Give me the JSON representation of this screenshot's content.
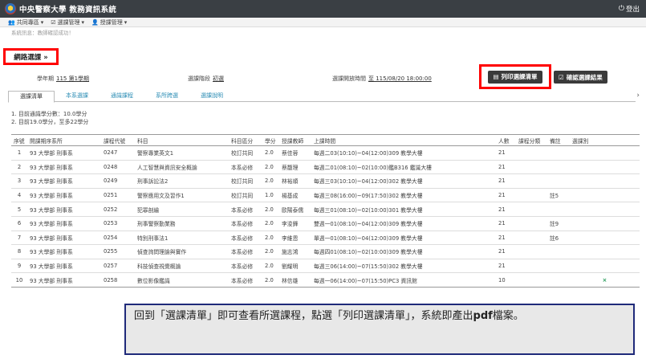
{
  "header": {
    "title": "中央警察大學 教務資訊系統",
    "logout": "登出"
  },
  "menu": [
    {
      "icon": "users-icon",
      "label": "共同專區"
    },
    {
      "icon": "checkbox-icon",
      "label": "選課管理"
    },
    {
      "icon": "user-icon",
      "label": "授課管理"
    }
  ],
  "notice": "系統訊息：教師確認成功！",
  "breadcrumb": "網路選課 »",
  "info": {
    "semester_label": "學年期",
    "semester_value": "115 第1學期",
    "stage_label": "選課階段",
    "stage_value": "初選",
    "open_label": "選課開放時間",
    "open_value": "至 115/08/20 18:00:00"
  },
  "buttons": {
    "print": "列印選課清單",
    "confirm": "確認選課結果"
  },
  "tabs": [
    "選課清單",
    "本系選課",
    "通識課程",
    "系所跨選",
    "選課說明"
  ],
  "summary": [
    "1. 目前通識學分數：10.0學分",
    "2. 目前19.0學分，至多22學分"
  ],
  "table": {
    "headers": [
      "序號",
      "開課期序系所",
      "課程代號",
      "科目",
      "科目區分",
      "學分",
      "授課教師",
      "上課時間",
      "人數",
      "課程分類",
      "備註",
      "選課別"
    ],
    "rows": [
      [
        "1",
        "93 大學部 刑事系",
        "0247",
        "警察專業英文1",
        "校訂共同",
        "2.0",
        "蔡佳蓉",
        "每週二03(10:10)~04(12:00)309 教學大樓",
        "21",
        "",
        "",
        ""
      ],
      [
        "2",
        "93 大學部 刑事系",
        "0248",
        "人工智慧與資訊安全概論",
        "本系必修",
        "2.0",
        "蔡馥理",
        "每週二01(08:10)~02(10:00)鑑B316 鑑識大樓",
        "21",
        "",
        "",
        ""
      ],
      [
        "3",
        "93 大學部 刑事系",
        "0249",
        "刑事訴訟法2",
        "校訂共同",
        "2.0",
        "林裕順",
        "每週三03(10:10)~04(12:00)302 教學大樓",
        "21",
        "",
        "",
        ""
      ],
      [
        "4",
        "93 大學部 刑事系",
        "0251",
        "警察應用文及習作1",
        "校訂共同",
        "1.0",
        "楊基成",
        "每週三08(16:00)~09(17:50)302 教學大樓",
        "21",
        "",
        "註5",
        ""
      ],
      [
        "5",
        "93 大學部 刑事系",
        "0252",
        "犯罪剖繪",
        "本系必修",
        "2.0",
        "歐陽泰儒",
        "每週三01(08:10)~02(10:00)301 教學大樓",
        "21",
        "",
        "",
        ""
      ],
      [
        "6",
        "93 大學部 刑事系",
        "0253",
        "刑事警察勤業務",
        "本系必修",
        "2.0",
        "李浚鋒",
        "雙週一01(08:10)~04(12:00)309 教學大樓",
        "21",
        "",
        "註9",
        ""
      ],
      [
        "7",
        "93 大學部 刑事系",
        "0254",
        "特別刑事法1",
        "本系必修",
        "2.0",
        "李維恩",
        "單週一01(08:10)~04(12:00)309 教學大樓",
        "21",
        "",
        "註6",
        ""
      ],
      [
        "8",
        "93 大學部 刑事系",
        "0255",
        "偵查詢問理論與實作",
        "本系必修",
        "2.0",
        "施志鴻",
        "每週四01(08:10)~02(10:00)309 教學大樓",
        "21",
        "",
        "",
        ""
      ],
      [
        "9",
        "93 大學部 刑事系",
        "0257",
        "科技偵查視覺概論",
        "本系必修",
        "2.0",
        "劉耀明",
        "每週三06(14:00)~07(15:50)302 教學大樓",
        "21",
        "",
        "",
        ""
      ],
      [
        "10",
        "93 大學部 刑事系",
        "0258",
        "數位影像鑑識",
        "本系必修",
        "2.0",
        "林信雄",
        "每週一06(14:00)~07(15:50)PC3 資訊館",
        "10",
        "",
        "",
        "×"
      ]
    ]
  },
  "callout": {
    "text": "回到「選課清單」即可查看所選課程，點選「列印選課清單」，系統即產出",
    "bold": "pdf",
    "tail": "檔案。"
  }
}
